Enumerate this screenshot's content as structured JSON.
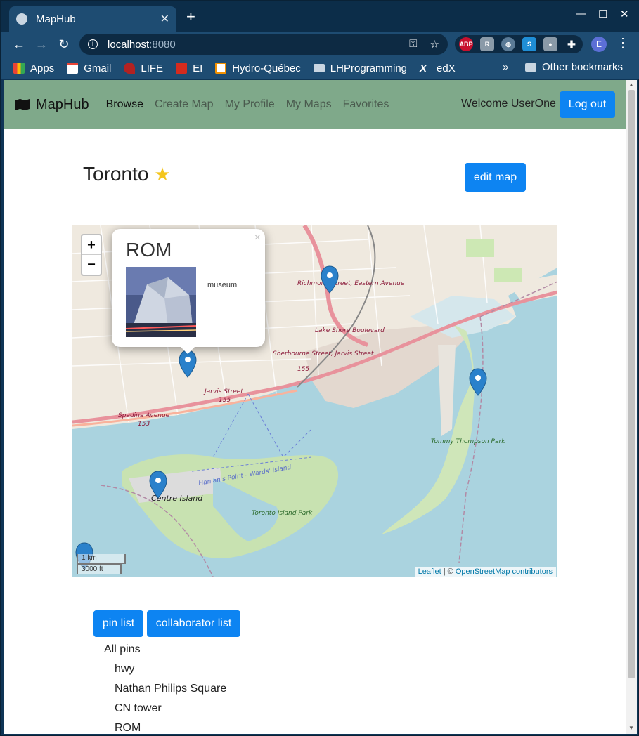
{
  "browser": {
    "tab_title": "MapHub",
    "url_host": "localhost",
    "url_port": ":8080",
    "bookmarks": [
      {
        "label": "Apps",
        "icon": "apps-grid-icon"
      },
      {
        "label": "Gmail",
        "icon": "gmail-icon"
      },
      {
        "label": "LIFE",
        "icon": "life-icon"
      },
      {
        "label": "EI",
        "icon": "maple-leaf-icon"
      },
      {
        "label": "Hydro-Québec",
        "icon": "hydro-quebec-icon"
      },
      {
        "label": "LHProgramming",
        "icon": "folder-icon"
      },
      {
        "label": "edX",
        "icon": "edx-icon"
      }
    ],
    "other_bookmarks": "Other bookmarks",
    "more_bookmarks": "»",
    "extensions": [
      "ABP",
      "R",
      "globe",
      "S",
      "bulb",
      "puzzle"
    ],
    "profile_initial": "E"
  },
  "nav": {
    "brand": "MapHub",
    "links": [
      "Browse",
      "Create Map",
      "My Profile",
      "My Maps",
      "Favorites"
    ],
    "welcome": "Welcome UserOne",
    "logout": "Log out"
  },
  "map_page": {
    "title": "Toronto",
    "favorite_icon": "star-icon",
    "edit_button": "edit map"
  },
  "map": {
    "zoom_in": "+",
    "zoom_out": "−",
    "popup": {
      "title": "ROM",
      "description": "museum",
      "close": "×"
    },
    "scale_km": "1 km",
    "scale_ft": "3000 ft",
    "attribution_leaflet": "Leaflet",
    "attribution_sep": " | © ",
    "attribution_osm": "OpenStreetMap contributors",
    "labels": {
      "richmond": "Richmond Street, Eastern Avenue",
      "lakeshore": "Lake Shore Boulevard",
      "sherbourne": "Sherbourne Street, Jarvis Street",
      "jarvis": "Jarvis Street",
      "spadina": "Spadina Avenue",
      "centre_island": "Centre Island",
      "toronto_island_park": "Toronto Island Park",
      "tommy_thompson": "Tommy Thompson Park",
      "ferry": "Hanlan's Point - Wards' Island",
      "route_155": "155",
      "route_153": "153"
    }
  },
  "tabs": {
    "pin_list": "pin list",
    "collaborator_list": "collaborator list"
  },
  "pins": {
    "heading": "All pins",
    "items": [
      "hwy",
      "Nathan Philips Square",
      "CN tower",
      "ROM"
    ]
  }
}
